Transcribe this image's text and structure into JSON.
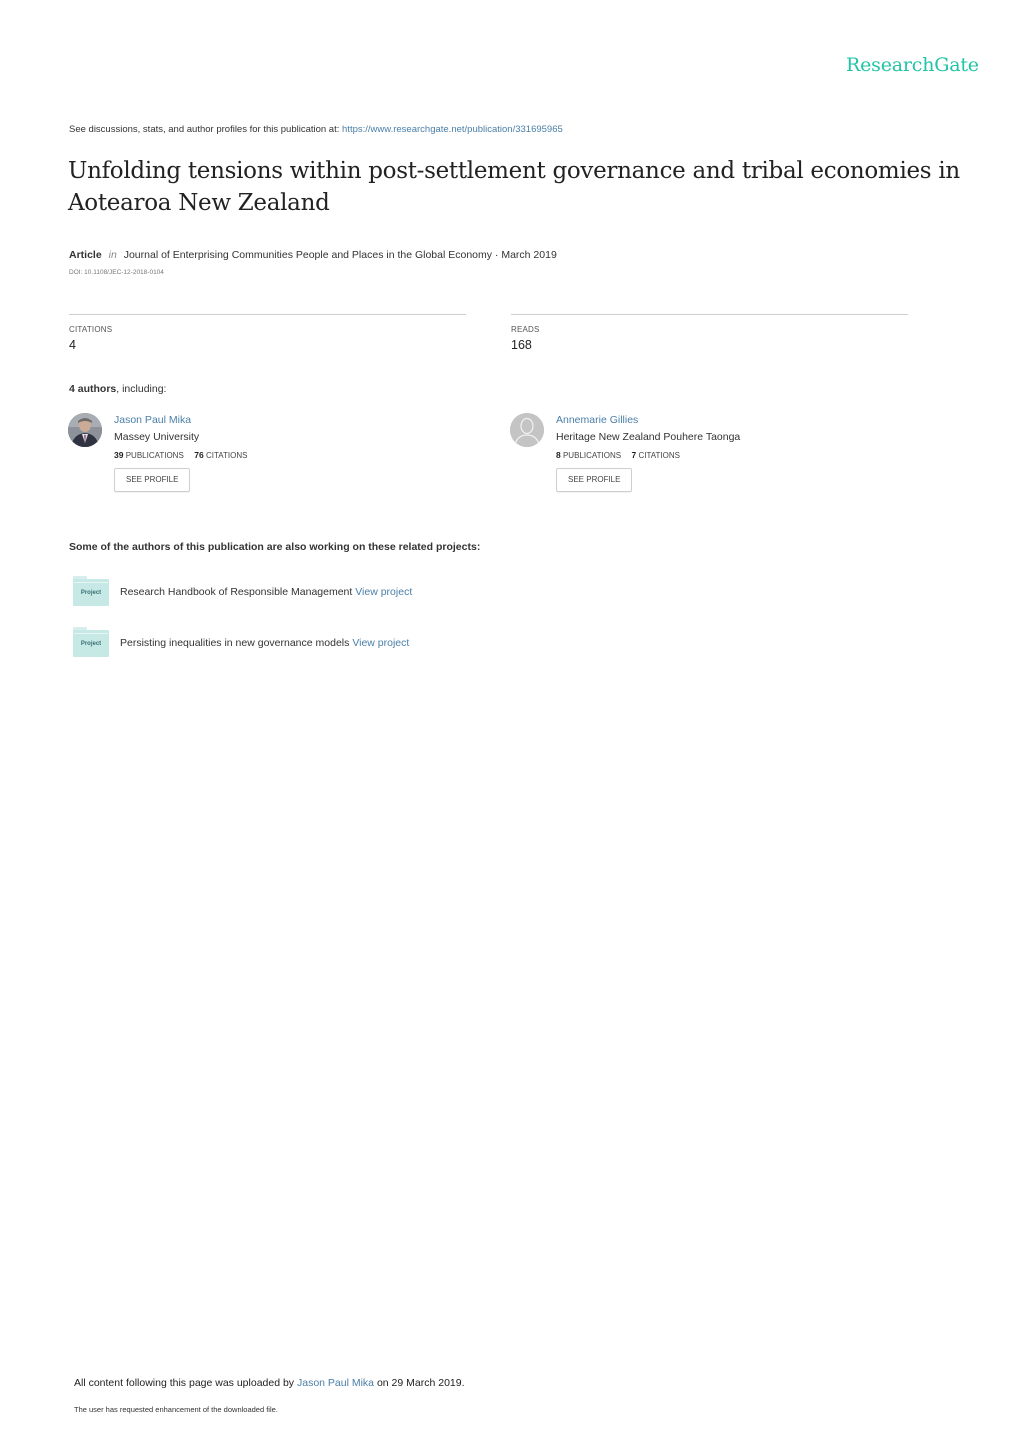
{
  "brand": {
    "name": "ResearchGate",
    "color": "#22c3a6"
  },
  "header": {
    "see_discussions_text": "See discussions, stats, and author profiles for this publication at:",
    "publication_url": "https://www.researchgate.net/publication/331695965"
  },
  "publication": {
    "title": "Unfolding tensions within post-settlement governance and tribal economies in Aotearoa New Zealand",
    "type": "Article",
    "in_label": "in",
    "journal": "Journal of Enterprising Communities People and Places in the Global Economy",
    "separator": " · ",
    "date": "March 2019",
    "doi": "DOI: 10.1108/JEC-12-2018-0104"
  },
  "stats": {
    "citations": {
      "label": "CITATIONS",
      "value": "4"
    },
    "reads": {
      "label": "READS",
      "value": "168"
    }
  },
  "authors_heading": {
    "count_label": "4 authors",
    "suffix": ", including:"
  },
  "authors": [
    {
      "name": "Jason Paul Mika",
      "affiliation": "Massey University",
      "publications": "39",
      "publications_label": "PUBLICATIONS",
      "citations": "76",
      "citations_label": "CITATIONS",
      "button_label": "SEE PROFILE",
      "avatar": "photo"
    },
    {
      "name": "Annemarie Gillies",
      "affiliation": "Heritage New Zealand Pouhere Taonga",
      "publications": "8",
      "publications_label": "PUBLICATIONS",
      "citations": "7",
      "citations_label": "CITATIONS",
      "button_label": "SEE PROFILE",
      "avatar": "placeholder"
    }
  ],
  "projects_heading": "Some of the authors of this publication are also working on these related projects:",
  "projects": [
    {
      "icon_label": "Project",
      "title": "Research Handbook of Responsible Management",
      "link_label": "View project"
    },
    {
      "icon_label": "Project",
      "title": "Persisting inequalities in new governance models",
      "link_label": "View project"
    }
  ],
  "footer": {
    "upload_prefix": "All content following this page was uploaded by",
    "uploader": "Jason Paul Mika",
    "upload_suffix": "on 29 March 2019.",
    "enhancement_note": "The user has requested enhancement of the downloaded file."
  }
}
